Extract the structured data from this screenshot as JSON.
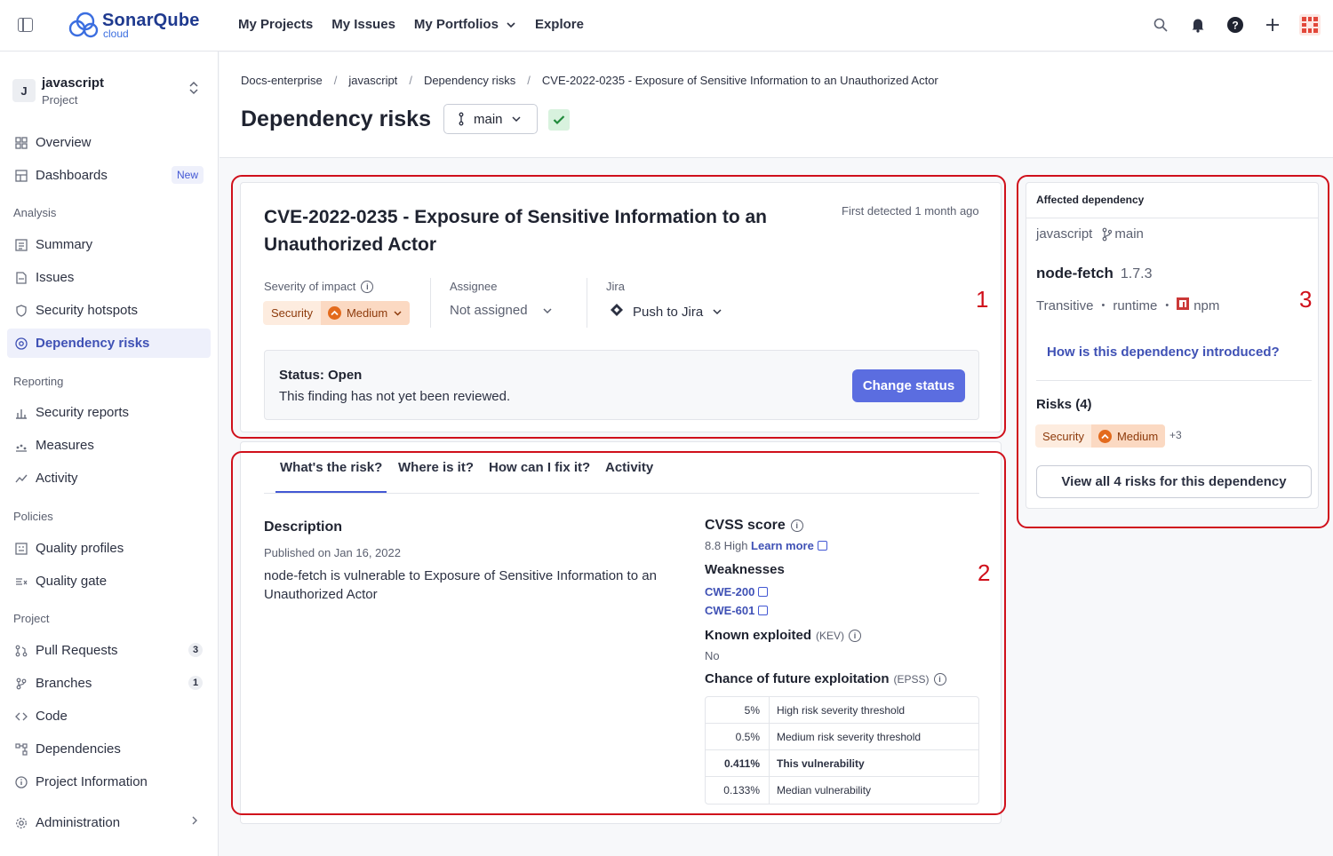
{
  "topbar": {
    "brand": "SonarQube",
    "brand_sub": "cloud",
    "nav": [
      "My Projects",
      "My Issues",
      "My Portfolios",
      "Explore"
    ]
  },
  "sidebar": {
    "project_avatar": "J",
    "project_name": "javascript",
    "project_type": "Project",
    "items": {
      "overview": "Overview",
      "dashboards": "Dashboards",
      "dashboards_badge": "New",
      "summary": "Summary",
      "issues": "Issues",
      "security_hotspots": "Security hotspots",
      "dependency_risks": "Dependency risks",
      "security_reports": "Security reports",
      "measures": "Measures",
      "activity": "Activity",
      "quality_profiles": "Quality profiles",
      "quality_gate": "Quality gate",
      "pull_requests": "Pull Requests",
      "pull_requests_count": "3",
      "branches": "Branches",
      "branches_count": "1",
      "code": "Code",
      "dependencies": "Dependencies",
      "project_information": "Project Information",
      "administration": "Administration"
    },
    "sections": {
      "analysis": "Analysis",
      "reporting": "Reporting",
      "policies": "Policies",
      "project": "Project"
    }
  },
  "breadcrumb": [
    "Docs-enterprise",
    "javascript",
    "Dependency risks",
    "CVE-2022-0235 - Exposure of Sensitive Information to an Unauthorized Actor"
  ],
  "page": {
    "title": "Dependency risks",
    "branch": "main"
  },
  "finding": {
    "title": "CVE-2022-0235 - Exposure of Sensitive Information to an Unauthorized Actor",
    "first_detected": "First detected 1 month ago",
    "severity_label": "Severity of impact",
    "severity_category": "Security",
    "severity_level": "Medium",
    "assignee_label": "Assignee",
    "assignee_value": "Not assigned",
    "jira_label": "Jira",
    "jira_value": "Push to Jira",
    "status_title": "Status: Open",
    "status_desc": "This finding has not yet been reviewed.",
    "change_status": "Change status"
  },
  "tabs": [
    "What's the risk?",
    "Where is it?",
    "How can I fix it?",
    "Activity"
  ],
  "risk": {
    "description_title": "Description",
    "published": "Published on Jan 16, 2022",
    "description": "node-fetch is vulnerable to Exposure of Sensitive Information to an Unauthorized Actor",
    "cvss_title": "CVSS score",
    "cvss_value": "8.8 High",
    "learn_more": "Learn more",
    "weaknesses_title": "Weaknesses",
    "cwes": [
      "CWE-200",
      "CWE-601"
    ],
    "kev_title": "Known exploited",
    "kev_abbr": "(KEV)",
    "kev_value": "No",
    "epss_title": "Chance of future exploitation",
    "epss_abbr": "(EPSS)",
    "epss_rows": [
      {
        "value": "5%",
        "label": "High risk severity threshold"
      },
      {
        "value": "0.5%",
        "label": "Medium risk severity threshold"
      },
      {
        "value": "0.411%",
        "label": "This vulnerability"
      },
      {
        "value": "0.133%",
        "label": "Median vulnerability"
      }
    ]
  },
  "affected": {
    "header": "Affected dependency",
    "project": "javascript",
    "branch": "main",
    "package": "node-fetch",
    "version": "1.7.3",
    "scope": "Transitive",
    "type": "runtime",
    "ecosystem": "npm",
    "how_introduced": "How is this dependency introduced?",
    "risks_title": "Risks (4)",
    "risk_category": "Security",
    "risk_level": "Medium",
    "risk_more": "+3",
    "view_all": "View all 4 risks for this dependency"
  },
  "annotations": [
    "1",
    "2",
    "3"
  ],
  "colors": {
    "accent": "#5b6de0",
    "highlight": "#d0101b",
    "severity_medium": "#e36a1c"
  }
}
